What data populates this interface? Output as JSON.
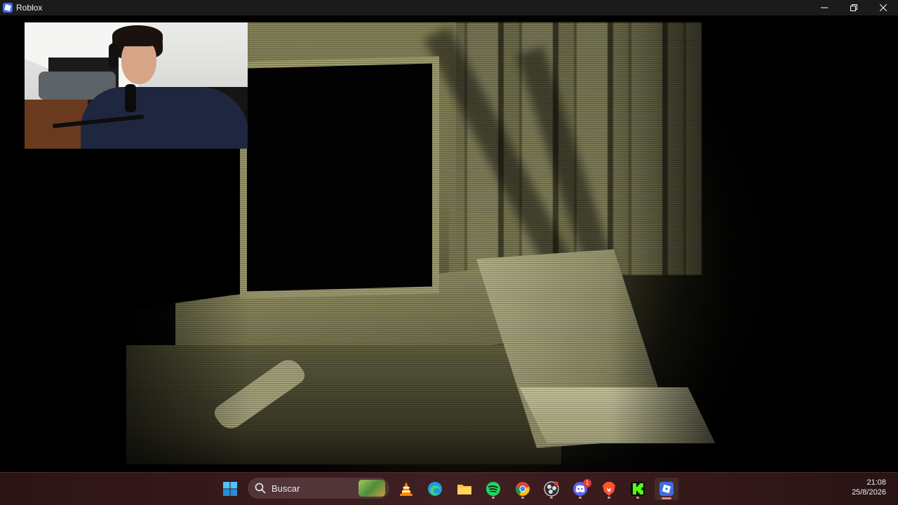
{
  "window": {
    "title": "Roblox",
    "controls": {
      "minimize": "minimize-icon",
      "restore": "restore-icon",
      "close": "close-icon"
    }
  },
  "game": {
    "scene": "dark-room-night-vision",
    "tint_color": "#6b6a45"
  },
  "webcam": {
    "visible": true
  },
  "taskbar": {
    "start_icon": "windows-start-icon",
    "search": {
      "placeholder": "Buscar"
    },
    "apps": [
      {
        "name": "vlc",
        "icon": "vlc-icon",
        "running": false
      },
      {
        "name": "edge",
        "icon": "edge-icon",
        "running": false
      },
      {
        "name": "file-explorer",
        "icon": "folder-icon",
        "running": false
      },
      {
        "name": "spotify",
        "icon": "spotify-icon",
        "running": true
      },
      {
        "name": "chrome",
        "icon": "chrome-icon",
        "running": true
      },
      {
        "name": "obs",
        "icon": "obs-icon",
        "running": true
      },
      {
        "name": "discord",
        "icon": "discord-icon",
        "running": true,
        "badge": "1"
      },
      {
        "name": "brave",
        "icon": "brave-icon",
        "running": true
      },
      {
        "name": "kick",
        "icon": "kick-icon",
        "running": true
      },
      {
        "name": "roblox",
        "icon": "roblox-icon",
        "running": true,
        "active": true
      }
    ],
    "clock": {
      "time": "21:08",
      "date": "25/8/2026"
    }
  },
  "colors": {
    "titlebar": "#1b1b1b",
    "taskbar": "#381a1c",
    "roblox_blue": "#3d6fe3",
    "spotify_green": "#1ed760",
    "discord_blurple": "#5865f2",
    "kick_green": "#53fc18",
    "brave_orange": "#fb542b"
  }
}
